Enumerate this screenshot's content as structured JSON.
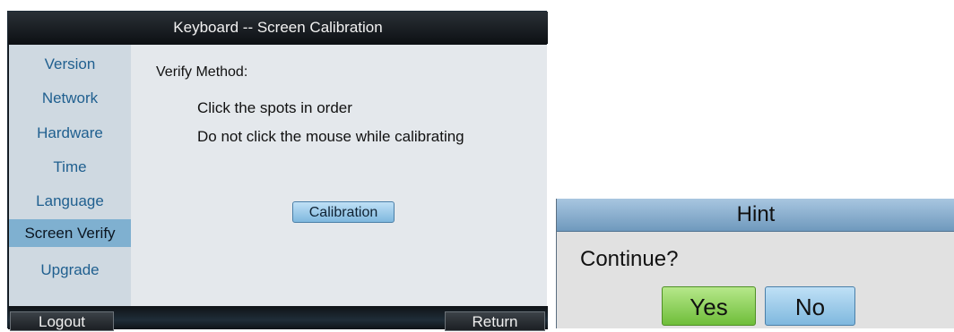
{
  "window": {
    "title": "Keyboard -- Screen Calibration"
  },
  "sidebar": {
    "items": [
      {
        "label": "Version"
      },
      {
        "label": "Network"
      },
      {
        "label": "Hardware"
      },
      {
        "label": "Time"
      },
      {
        "label": "Language"
      },
      {
        "label": "Screen Verify",
        "active": true
      },
      {
        "label": "Upgrade"
      }
    ]
  },
  "content": {
    "heading": "Verify Method:",
    "lines": [
      "Click the spots in order",
      "Do not click the mouse while calibrating"
    ],
    "calibration_button": "Calibration"
  },
  "bottom_bar": {
    "logout": "Logout",
    "return": "Return"
  },
  "hint_dialog": {
    "title": "Hint",
    "question": "Continue?",
    "yes": "Yes",
    "no": "No"
  },
  "colors": {
    "title_bar": "#1a1f24",
    "sidebar_bg": "#cfd9e1",
    "sidebar_text": "#1f5f8f",
    "active_item": "#7fb0d0",
    "content_bg": "#e4e8ec",
    "button_blue": "#9ccbea",
    "button_green": "#8fd35a"
  }
}
